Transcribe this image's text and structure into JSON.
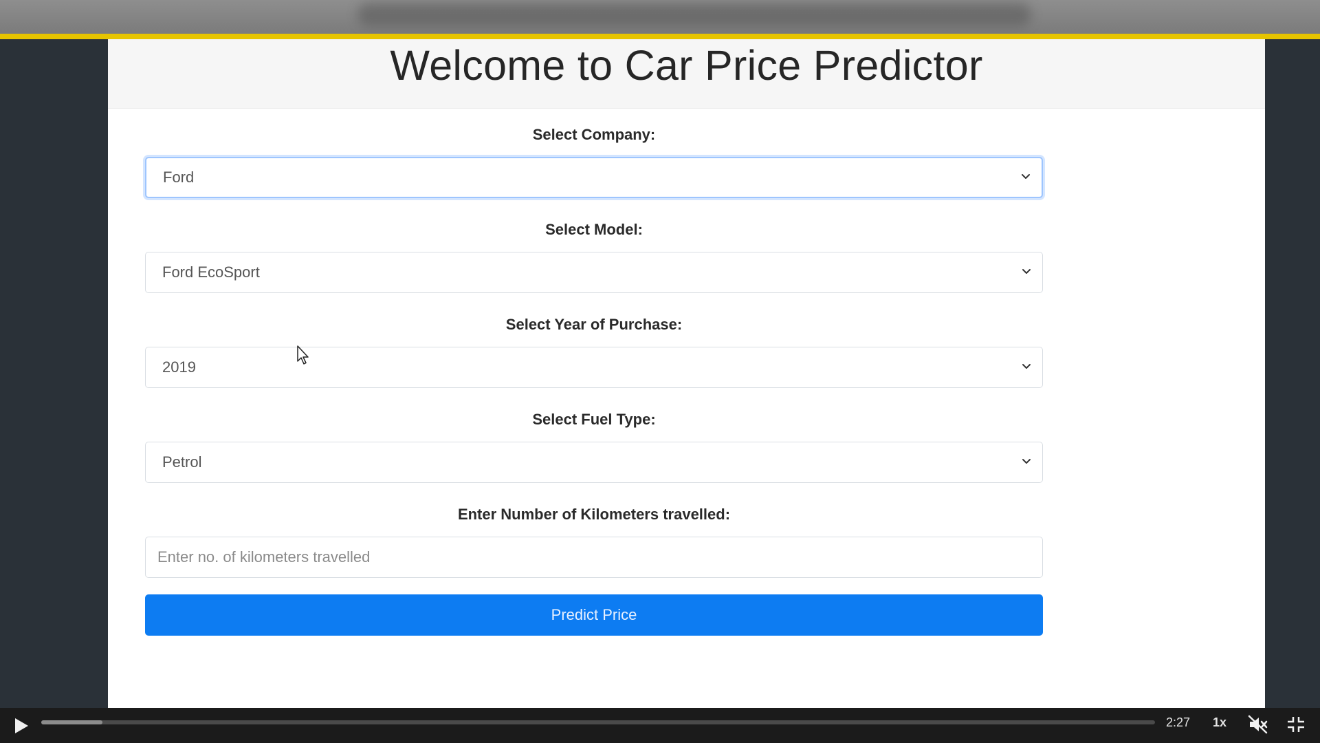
{
  "page": {
    "title": "Welcome to Car Price Predictor"
  },
  "form": {
    "company": {
      "label": "Select Company:",
      "value": "Ford"
    },
    "model": {
      "label": "Select Model:",
      "value": "Ford EcoSport"
    },
    "year": {
      "label": "Select Year of Purchase:",
      "value": "2019"
    },
    "fuel": {
      "label": "Select Fuel Type:",
      "value": "Petrol"
    },
    "kms": {
      "label": "Enter Number of Kilometers travelled:",
      "placeholder": "Enter no. of kilometers travelled",
      "value": ""
    },
    "submit_label": "Predict Price"
  },
  "player": {
    "time": "2:27",
    "speed": "1x",
    "progress_fraction": 0.055,
    "muted": true,
    "icons": {
      "play": "play-icon",
      "mute": "volume-muted-icon",
      "fullscreen": "exit-fullscreen-icon",
      "chevron": "chevron-down-icon",
      "cursor": "mouse-pointer-icon"
    }
  },
  "colors": {
    "accent_yellow": "#e6c400",
    "button_blue": "#0d7cf2",
    "focus_border": "#9ec5fe"
  }
}
